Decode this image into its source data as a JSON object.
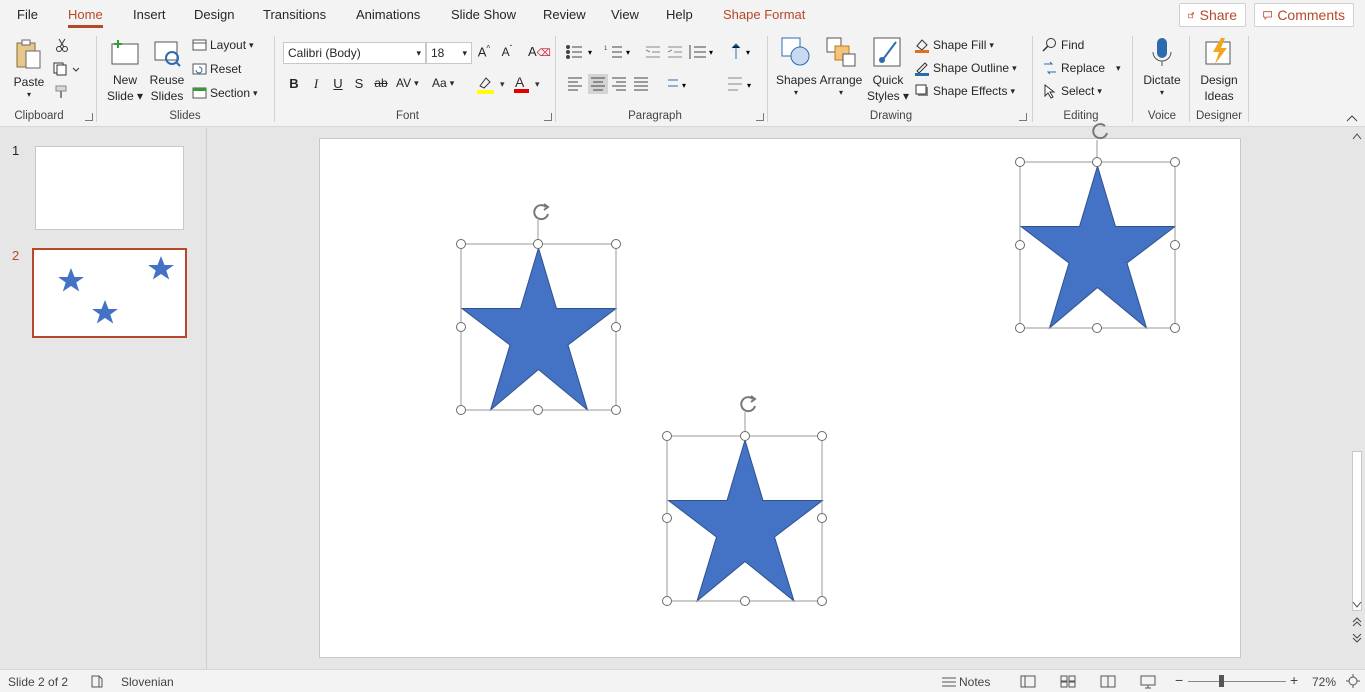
{
  "tabs": [
    {
      "label": "File"
    },
    {
      "label": "Home"
    },
    {
      "label": "Insert"
    },
    {
      "label": "Design"
    },
    {
      "label": "Transitions"
    },
    {
      "label": "Animations"
    },
    {
      "label": "Slide Show"
    },
    {
      "label": "Review"
    },
    {
      "label": "View"
    },
    {
      "label": "Help"
    },
    {
      "label": "Shape Format"
    }
  ],
  "top_actions": {
    "share": "Share",
    "comments": "Comments"
  },
  "ribbon": {
    "clipboard": {
      "paste": "Paste",
      "label": "Clipboard"
    },
    "slides": {
      "new_slide_1": "New",
      "new_slide_2": "Slide",
      "reuse_1": "Reuse",
      "reuse_2": "Slides",
      "layout": "Layout",
      "reset": "Reset",
      "section": "Section",
      "label": "Slides"
    },
    "font": {
      "family": "Calibri (Body)",
      "size": "18",
      "bold": "B",
      "italic": "I",
      "underline": "U",
      "shadow": "S",
      "strike": "ab",
      "spacing": "AV",
      "case": "Aa",
      "label": "Font"
    },
    "paragraph": {
      "label": "Paragraph"
    },
    "drawing": {
      "shapes": "Shapes",
      "arrange": "Arrange",
      "quick_1": "Quick",
      "quick_2": "Styles",
      "fill": "Shape Fill",
      "outline": "Shape Outline",
      "effects": "Shape Effects",
      "label": "Drawing"
    },
    "editing": {
      "find": "Find",
      "replace": "Replace",
      "select": "Select",
      "label": "Editing"
    },
    "voice": {
      "dictate": "Dictate",
      "label": "Voice"
    },
    "designer": {
      "ideas_1": "Design",
      "ideas_2": "Ideas",
      "label": "Designer"
    }
  },
  "thumbnails": [
    {
      "num": "1"
    },
    {
      "num": "2"
    }
  ],
  "colors": {
    "accent": "#b7472a",
    "star_fill": "#4472c4",
    "star_stroke": "#2f528f"
  },
  "status": {
    "slide": "Slide 2 of 2",
    "language": "Slovenian",
    "notes": "Notes",
    "zoom": "72%"
  }
}
